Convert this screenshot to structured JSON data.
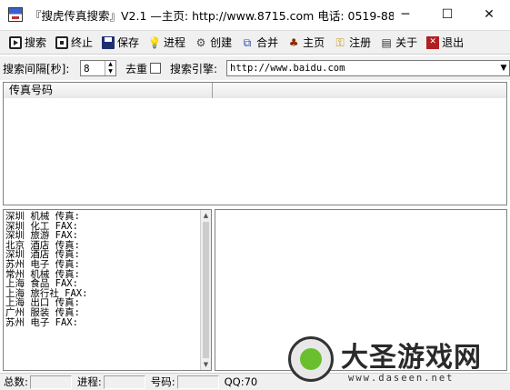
{
  "window": {
    "title": "『搜虎传真搜索』V2.1 —主页: http://www.8715.com 电话: 0519-88...",
    "controls": {
      "minimize": "─",
      "maximize": "☐",
      "close": "✕"
    }
  },
  "toolbar": {
    "search": "搜索",
    "stop": "终止",
    "save": "保存",
    "process": "进程",
    "create": "创建",
    "merge": "合并",
    "home": "主页",
    "register": "注册",
    "about": "关于",
    "exit": "退出"
  },
  "options": {
    "interval_label": "搜索间隔[秒]:",
    "interval_value": "8",
    "dedupe_label": "去重",
    "engine_label": "搜索引擎:",
    "engine_value": "http://www.baidu.com"
  },
  "results": {
    "columns": [
      "传真号码",
      ""
    ]
  },
  "keywords": [
    "深圳 机械 传真:",
    "深圳 化工 FAX:",
    "深圳 旅游 FAX:",
    "北京 酒店 传真:",
    "深圳 酒店 传真:",
    "苏州 电子 传真:",
    "常州 机械 传真:",
    "上海 食品 FAX:",
    "上海 旅行社 FAX:",
    "上海 出口 传真:",
    "广州 服装 传真:",
    "苏州 电子 FAX:"
  ],
  "status": {
    "total_label": "总数:",
    "progress_label": "进程:",
    "number_label": "号码:",
    "qq_label": "QQ:70"
  },
  "watermark": {
    "title": "大圣游戏网",
    "url": "www.daseen.net"
  }
}
